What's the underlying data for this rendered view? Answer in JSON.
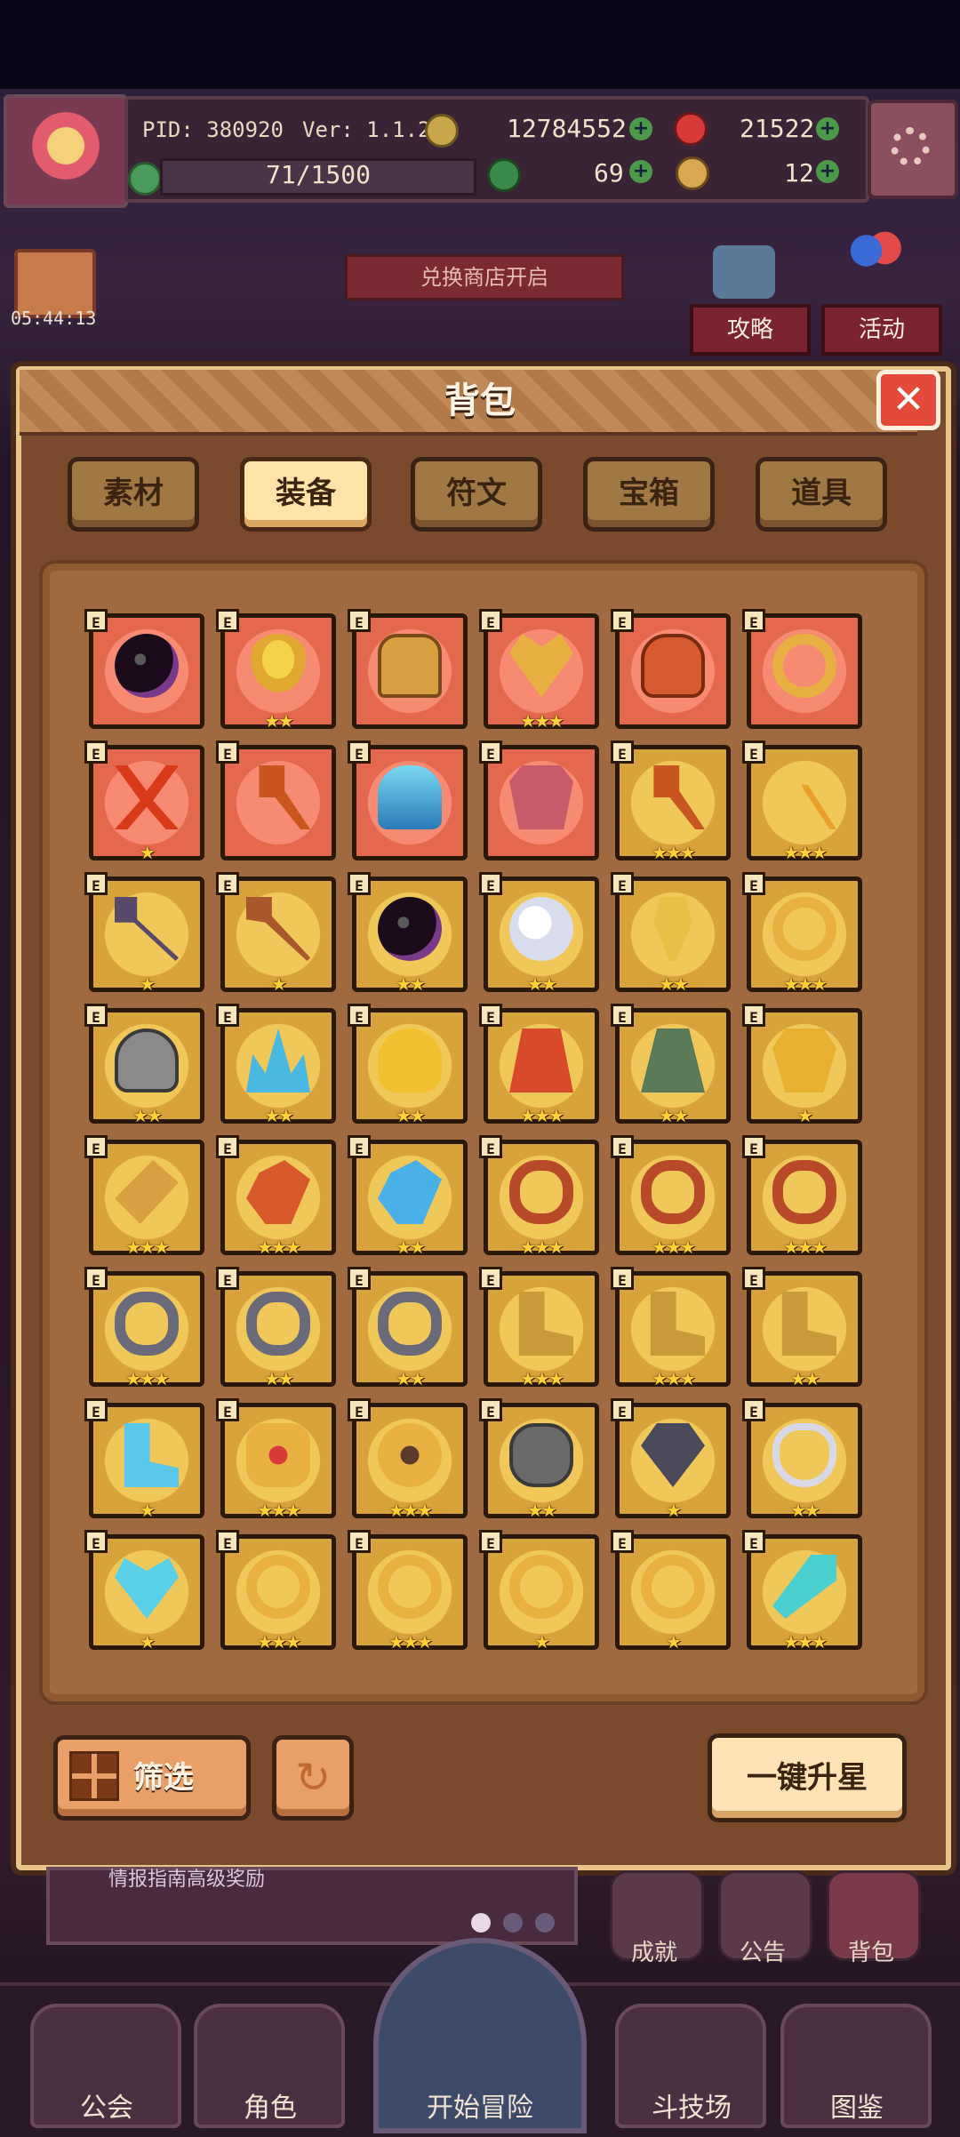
{
  "header": {
    "pid": "PID: 380920",
    "version": "Ver: 1.1.2.5",
    "gold": "12784552",
    "gems": "21522",
    "stamina": "71/1500",
    "clover": "69",
    "keys": "12"
  },
  "timer": "05:44:13",
  "shop_banner": "兑换商店开启",
  "side_buttons": {
    "guide": "攻略",
    "event": "活动"
  },
  "modal": {
    "title": "背包",
    "tabs": [
      {
        "label": "素材",
        "active": false
      },
      {
        "label": "装备",
        "active": true
      },
      {
        "label": "符文",
        "active": false
      },
      {
        "label": "宝箱",
        "active": false
      },
      {
        "label": "道具",
        "active": false
      }
    ],
    "filter_label": "筛选",
    "upgrade_label": "一键升星",
    "items": [
      {
        "name": "dark-orb",
        "bg": "red",
        "stars": 0,
        "badge": "E",
        "icon": "orb"
      },
      {
        "name": "straw-hat",
        "bg": "red",
        "stars": 2,
        "badge": "E",
        "icon": "hat"
      },
      {
        "name": "horned-helmet",
        "bg": "red",
        "stars": 0,
        "badge": "E",
        "icon": "helmet"
      },
      {
        "name": "heart-amulet",
        "bg": "red",
        "stars": 3,
        "badge": "E",
        "icon": "amulet"
      },
      {
        "name": "red-pot",
        "bg": "red",
        "stars": 0,
        "badge": "E",
        "icon": "pot"
      },
      {
        "name": "gold-ring",
        "bg": "red",
        "stars": 0,
        "badge": "E",
        "icon": "ring"
      },
      {
        "name": "twin-blades",
        "bg": "red",
        "stars": 1,
        "badge": "E",
        "icon": "blades"
      },
      {
        "name": "fire-axe",
        "bg": "red",
        "stars": 0,
        "badge": "E",
        "icon": "axe"
      },
      {
        "name": "crystal-helm",
        "bg": "red",
        "stars": 0,
        "badge": "E",
        "icon": "crystal-helm"
      },
      {
        "name": "chain-armor",
        "bg": "red",
        "stars": 0,
        "badge": "E",
        "icon": "armor"
      },
      {
        "name": "bone-axe",
        "bg": "gold",
        "stars": 3,
        "badge": "E",
        "icon": "axe"
      },
      {
        "name": "trident",
        "bg": "gold",
        "stars": 3,
        "badge": "E",
        "icon": "trident"
      },
      {
        "name": "spiked-mace",
        "bg": "gold",
        "stars": 1,
        "badge": "E",
        "icon": "mace"
      },
      {
        "name": "wooden-staff",
        "bg": "gold",
        "stars": 1,
        "badge": "E",
        "icon": "staff"
      },
      {
        "name": "jade-orb",
        "bg": "gold",
        "stars": 2,
        "badge": "E",
        "icon": "orb"
      },
      {
        "name": "pearl-orb",
        "bg": "gold",
        "stars": 2,
        "badge": "E",
        "icon": "pearl"
      },
      {
        "name": "gem-scepter",
        "bg": "gold",
        "stars": 2,
        "badge": "E",
        "icon": "scepter"
      },
      {
        "name": "gold-circlet",
        "bg": "gold",
        "stars": 3,
        "badge": "E",
        "icon": "ring"
      },
      {
        "name": "stone-hood",
        "bg": "gold",
        "stars": 2,
        "badge": "E",
        "icon": "hood"
      },
      {
        "name": "ice-crown",
        "bg": "gold",
        "stars": 2,
        "badge": "E",
        "icon": "crown"
      },
      {
        "name": "gold-cap",
        "bg": "gold",
        "stars": 2,
        "badge": "E",
        "icon": "cap"
      },
      {
        "name": "flame-robe",
        "bg": "gold",
        "stars": 3,
        "badge": "E",
        "icon": "robe"
      },
      {
        "name": "leaf-cloak",
        "bg": "gold",
        "stars": 2,
        "badge": "E",
        "icon": "cloak"
      },
      {
        "name": "gold-vest",
        "bg": "gold",
        "stars": 1,
        "badge": "E",
        "icon": "vest"
      },
      {
        "name": "gold-bracer",
        "bg": "gold",
        "stars": 3,
        "badge": "E",
        "icon": "bracer"
      },
      {
        "name": "fire-glove",
        "bg": "gold",
        "stars": 3,
        "badge": "E",
        "icon": "glove"
      },
      {
        "name": "ice-glove",
        "bg": "gold",
        "stars": 2,
        "badge": "E",
        "icon": "ice-glove"
      },
      {
        "name": "emerald-belt",
        "bg": "gold",
        "stars": 3,
        "badge": "E",
        "icon": "belt"
      },
      {
        "name": "red-belt",
        "bg": "gold",
        "stars": 3,
        "badge": "E",
        "icon": "belt"
      },
      {
        "name": "ruby-belt",
        "bg": "gold",
        "stars": 3,
        "badge": "E",
        "icon": "belt"
      },
      {
        "name": "bronze-collar",
        "bg": "gold",
        "stars": 3,
        "badge": "E",
        "icon": "collar"
      },
      {
        "name": "iron-collar",
        "bg": "gold",
        "stars": 2,
        "badge": "E",
        "icon": "collar"
      },
      {
        "name": "steel-collar",
        "bg": "gold",
        "stars": 2,
        "badge": "E",
        "icon": "collar"
      },
      {
        "name": "gold-boots",
        "bg": "gold",
        "stars": 3,
        "badge": "E",
        "icon": "boots"
      },
      {
        "name": "ember-boots",
        "bg": "gold",
        "stars": 3,
        "badge": "E",
        "icon": "boots"
      },
      {
        "name": "shadow-boots",
        "bg": "gold",
        "stars": 2,
        "badge": "E",
        "icon": "boots"
      },
      {
        "name": "frost-boots",
        "bg": "gold",
        "stars": 1,
        "badge": "E",
        "icon": "ice-boots"
      },
      {
        "name": "ruby-medallion",
        "bg": "gold",
        "stars": 3,
        "badge": "E",
        "icon": "medallion"
      },
      {
        "name": "sun-medallion",
        "bg": "gold",
        "stars": 3,
        "badge": "E",
        "icon": "sun"
      },
      {
        "name": "iron-shield",
        "bg": "gold",
        "stars": 2,
        "badge": "E",
        "icon": "shield"
      },
      {
        "name": "dark-pendant",
        "bg": "gold",
        "stars": 1,
        "badge": "E",
        "icon": "pendant"
      },
      {
        "name": "pearl-necklace",
        "bg": "gold",
        "stars": 2,
        "badge": "E",
        "icon": "necklace"
      },
      {
        "name": "heart-pendant",
        "bg": "gold",
        "stars": 1,
        "badge": "E",
        "icon": "heart"
      },
      {
        "name": "crown-ring",
        "bg": "gold",
        "stars": 3,
        "badge": "E",
        "icon": "ring"
      },
      {
        "name": "emerald-ring",
        "bg": "gold",
        "stars": 3,
        "badge": "E",
        "icon": "ring"
      },
      {
        "name": "ruby-ring",
        "bg": "gold",
        "stars": 1,
        "badge": "E",
        "icon": "ring"
      },
      {
        "name": "diamond-ring",
        "bg": "gold",
        "stars": 1,
        "badge": "E",
        "icon": "ring"
      },
      {
        "name": "ice-wand",
        "bg": "gold",
        "stars": 3,
        "badge": "E",
        "icon": "wand"
      }
    ]
  },
  "quick_buttons": {
    "achievement": "成就",
    "notice": "公告",
    "bag": "背包"
  },
  "nav": {
    "guild": "公会",
    "character": "角色",
    "start": "开始冒险",
    "arena": "斗技场",
    "codex": "图鉴"
  },
  "news_text": "情报指南高级奖励"
}
